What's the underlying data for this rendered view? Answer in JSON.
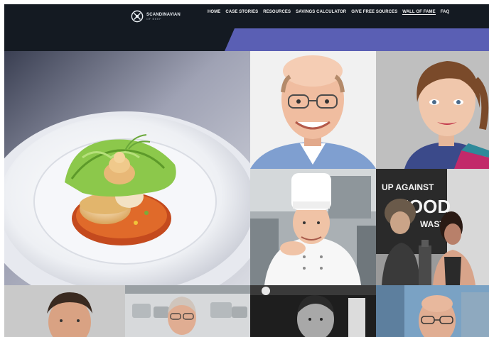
{
  "brand": {
    "logo_line1": "SCANDINAVIAN",
    "logo_line2": "OF BEEF"
  },
  "nav": {
    "items": [
      {
        "label": "HOME",
        "active": false
      },
      {
        "label": "CASE STORIES",
        "active": false
      },
      {
        "label": "RESOURCES",
        "active": false
      },
      {
        "label": "SAVINGS CALCULATOR",
        "active": false
      },
      {
        "label": "GIVE FREE SOURCES",
        "active": false
      },
      {
        "label": "WALL OF FAME",
        "active": true
      },
      {
        "label": "FAQ",
        "active": false
      }
    ]
  },
  "gallery": {
    "poster_text": {
      "line1": "UP AGAINST",
      "line2": "FOOD",
      "line3": "WAST"
    }
  },
  "colors": {
    "topbar": "#141a22",
    "banner_accent": "#5a5fb4",
    "page_bg": "#ffffff"
  }
}
